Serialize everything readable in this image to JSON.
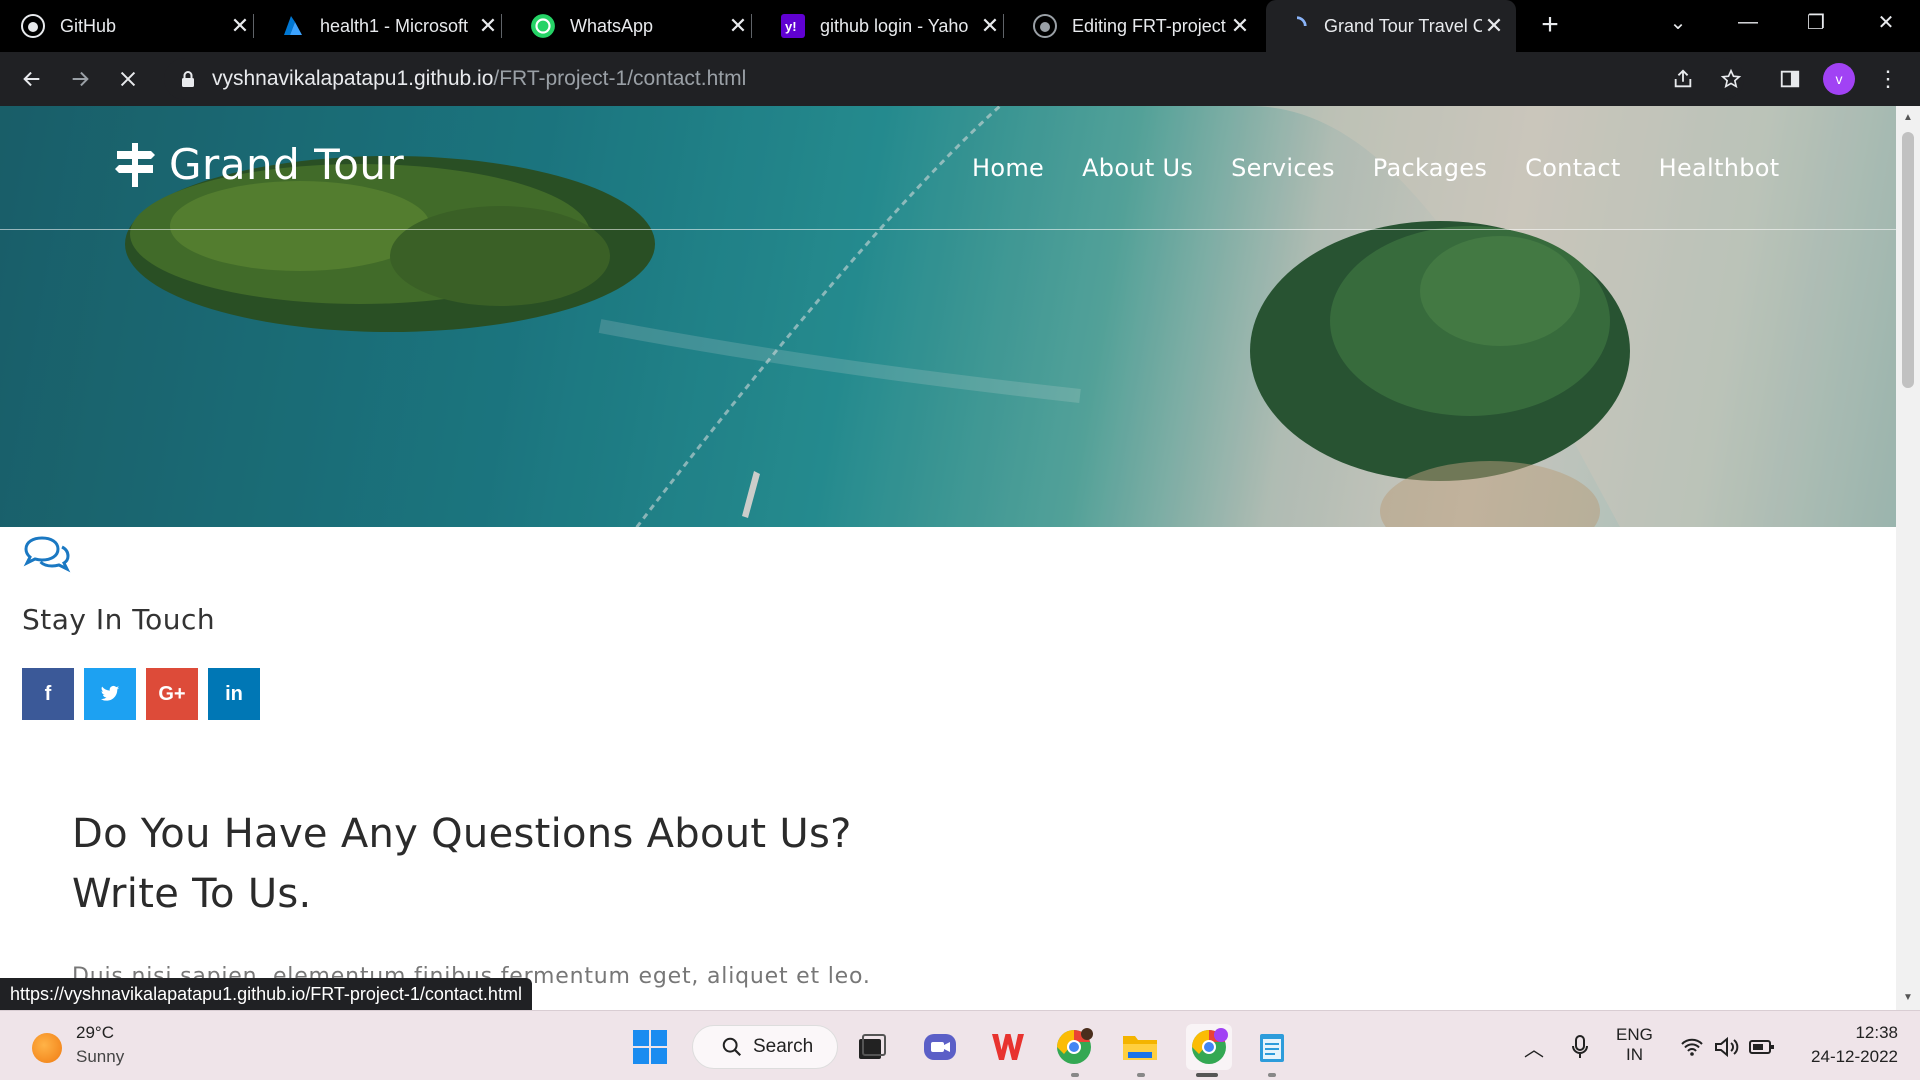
{
  "browser": {
    "tabs": [
      {
        "title": "GitHub",
        "icon": "github-icon"
      },
      {
        "title": "health1 - Microsoft",
        "icon": "azure-icon"
      },
      {
        "title": "WhatsApp",
        "icon": "whatsapp-icon"
      },
      {
        "title": "github login - Yaho",
        "icon": "yahoo-icon"
      },
      {
        "title": "Editing FRT-project",
        "icon": "github-icon"
      },
      {
        "title": "Grand Tour Travel C",
        "icon": "loading-icon",
        "active": true
      }
    ],
    "url_domain": "vyshnavikalapatapu1.github.io",
    "url_path": "/FRT-project-1/contact.html",
    "profile_initial": "v",
    "status_url": "https://vyshnavikalapatapu1.github.io/FRT-project-1/contact.html"
  },
  "site": {
    "brand": "Grand Tour",
    "nav": [
      "Home",
      "About Us",
      "Services",
      "Packages",
      "Contact",
      "Healthbot"
    ],
    "active_nav": "Contact",
    "stay_title": "Stay In Touch",
    "social": [
      {
        "label": "f",
        "name": "facebook",
        "color": "#3b5998"
      },
      {
        "label": "t",
        "name": "twitter",
        "color": "#1da1f2"
      },
      {
        "label": "G+",
        "name": "google-plus",
        "color": "#dd4b39"
      },
      {
        "label": "in",
        "name": "linkedin",
        "color": "#0077b5"
      }
    ],
    "headline_line1": "Do You Have Any Questions About Us?",
    "headline_line2": "Write To Us.",
    "paragraph": "Duis nisi sapien, elementum finibus fermentum eget, aliquet et leo.",
    "accent": "#1a78c2"
  },
  "taskbar": {
    "temperature": "29°C",
    "condition": "Sunny",
    "search_label": "Search",
    "lang": "ENG",
    "region": "IN",
    "time": "12:38",
    "date": "24-12-2022"
  }
}
